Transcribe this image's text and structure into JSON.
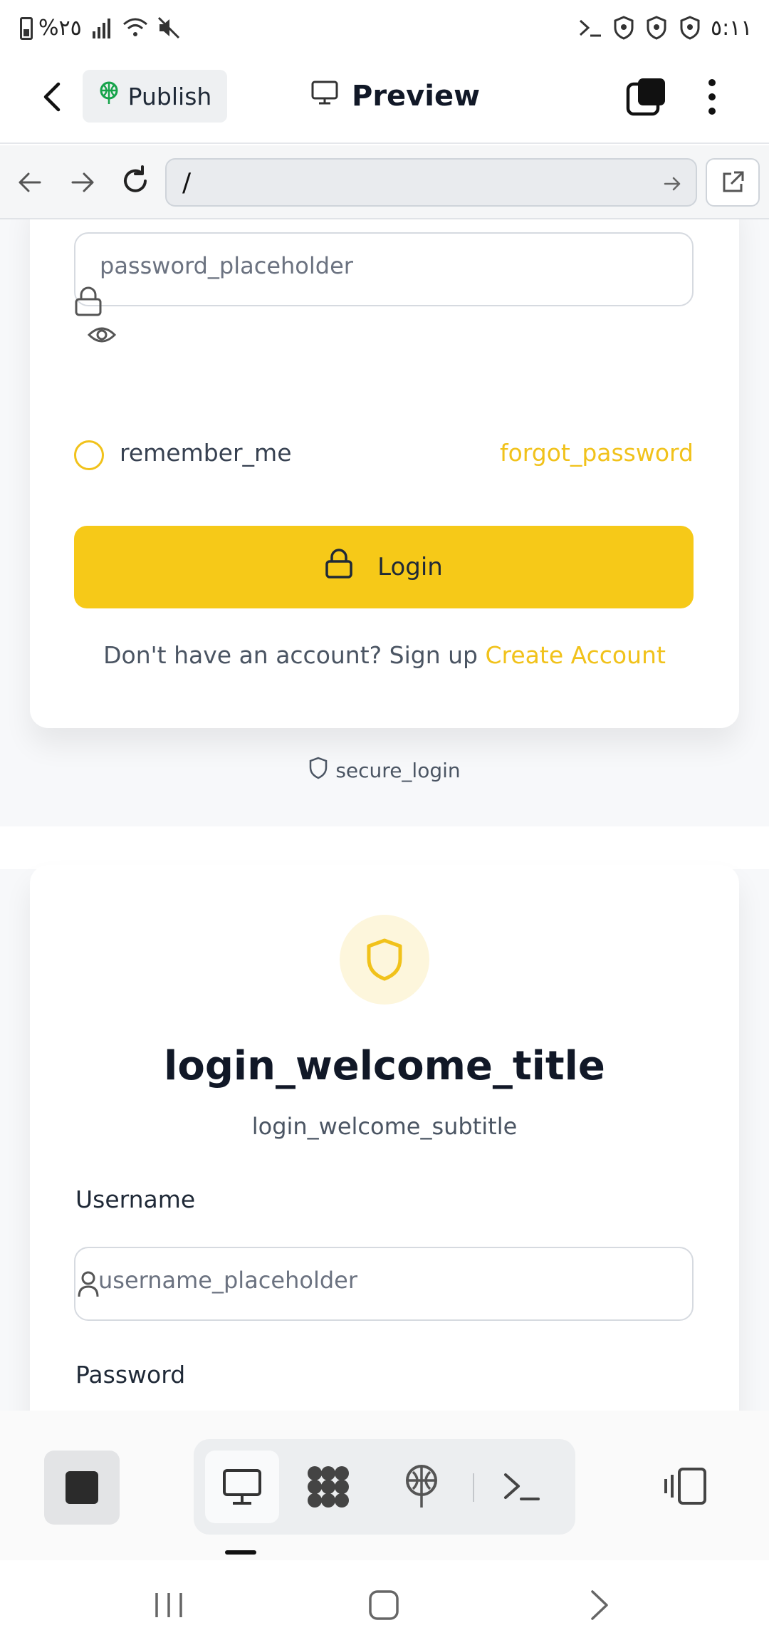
{
  "status_bar": {
    "left_text": "%٢٥",
    "time": "٥:١١"
  },
  "appbar": {
    "publish_label": "Publish",
    "preview_label": "Preview"
  },
  "browser": {
    "url": "/"
  },
  "top_card": {
    "password_placeholder": "password_placeholder",
    "remember_label": "remember_me",
    "forgot_label": "forgot_password",
    "login_label": "Login",
    "signup_prompt": "Don't have an account? Sign up",
    "create_account": "Create Account"
  },
  "secure_label": "secure_login",
  "bottom_card": {
    "title": "login_welcome_title",
    "subtitle": "login_welcome_subtitle",
    "username_label": "Username",
    "username_placeholder": "username_placeholder",
    "password_label": "Password"
  },
  "colors": {
    "accent": "#f6c918",
    "accent_text": "#f1c21b"
  }
}
